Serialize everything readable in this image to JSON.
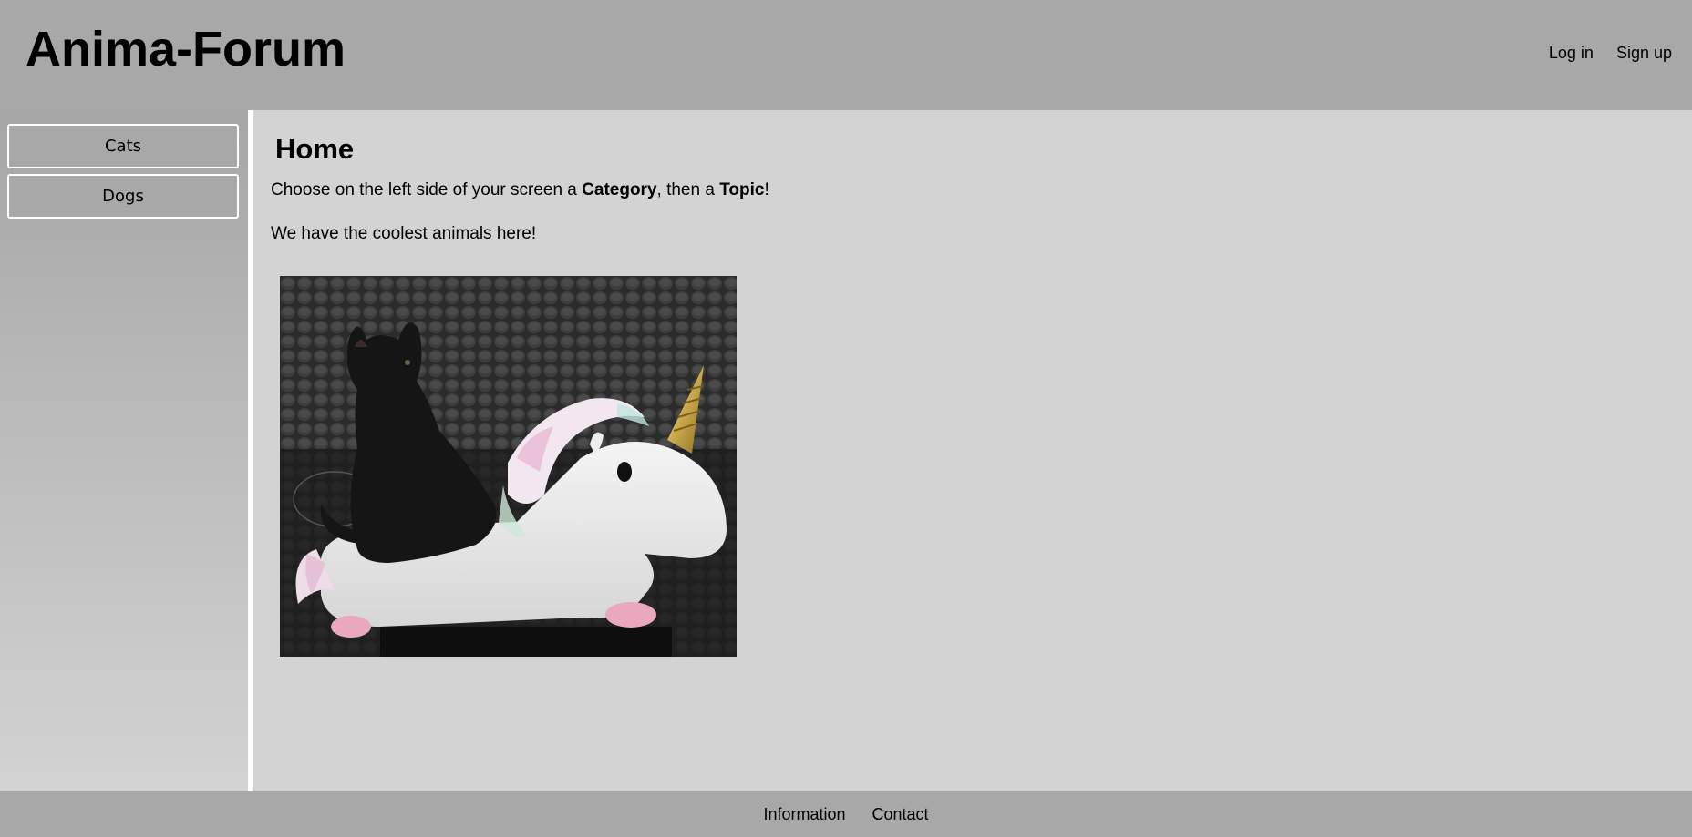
{
  "header": {
    "title": "Anima-Forum",
    "login_label": "Log in",
    "signup_label": "Sign up"
  },
  "sidebar": {
    "categories": [
      {
        "label": "Cats"
      },
      {
        "label": "Dogs"
      }
    ]
  },
  "main": {
    "heading": "Home",
    "intro": {
      "part1": "Choose on the left side of your screen a ",
      "bold1": "Category",
      "part2": ", then a ",
      "bold2": "Topic",
      "part3": "!"
    },
    "tagline": "We have the coolest animals here!"
  },
  "footer": {
    "links": [
      {
        "label": "Information"
      },
      {
        "label": "Contact"
      }
    ]
  },
  "colors": {
    "header_bg": "#a8a8a8",
    "content_bg": "#d3d3d3",
    "divider": "#ffffff"
  }
}
